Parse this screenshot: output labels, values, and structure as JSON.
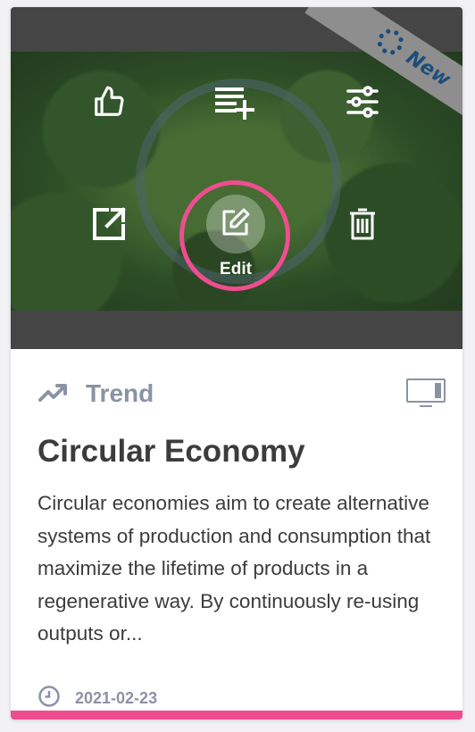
{
  "card": {
    "badge": {
      "label": "New"
    },
    "actions": {
      "like": {
        "icon": "thumbs-up-icon"
      },
      "add_to_list": {
        "icon": "playlist-add-icon"
      },
      "settings": {
        "icon": "sliders-icon"
      },
      "open": {
        "icon": "external-link-icon"
      },
      "edit": {
        "icon": "edit-icon",
        "label": "Edit"
      },
      "delete": {
        "icon": "trash-icon"
      }
    },
    "type": {
      "label": "Trend",
      "icon": "trend-up-icon"
    },
    "device_icon": "monitor-icon",
    "title": "Circular Economy",
    "description": "Circular economies aim to create alternative systems of production and consumption that maximize the lifetime of products in a regenerative way. By continuously re-using outputs or...",
    "date": "2021-02-23",
    "colors": {
      "accent": "#ee4d8f",
      "badge_text": "#1d4e79",
      "muted": "#8a92a6",
      "text": "#3c3c3c"
    }
  }
}
